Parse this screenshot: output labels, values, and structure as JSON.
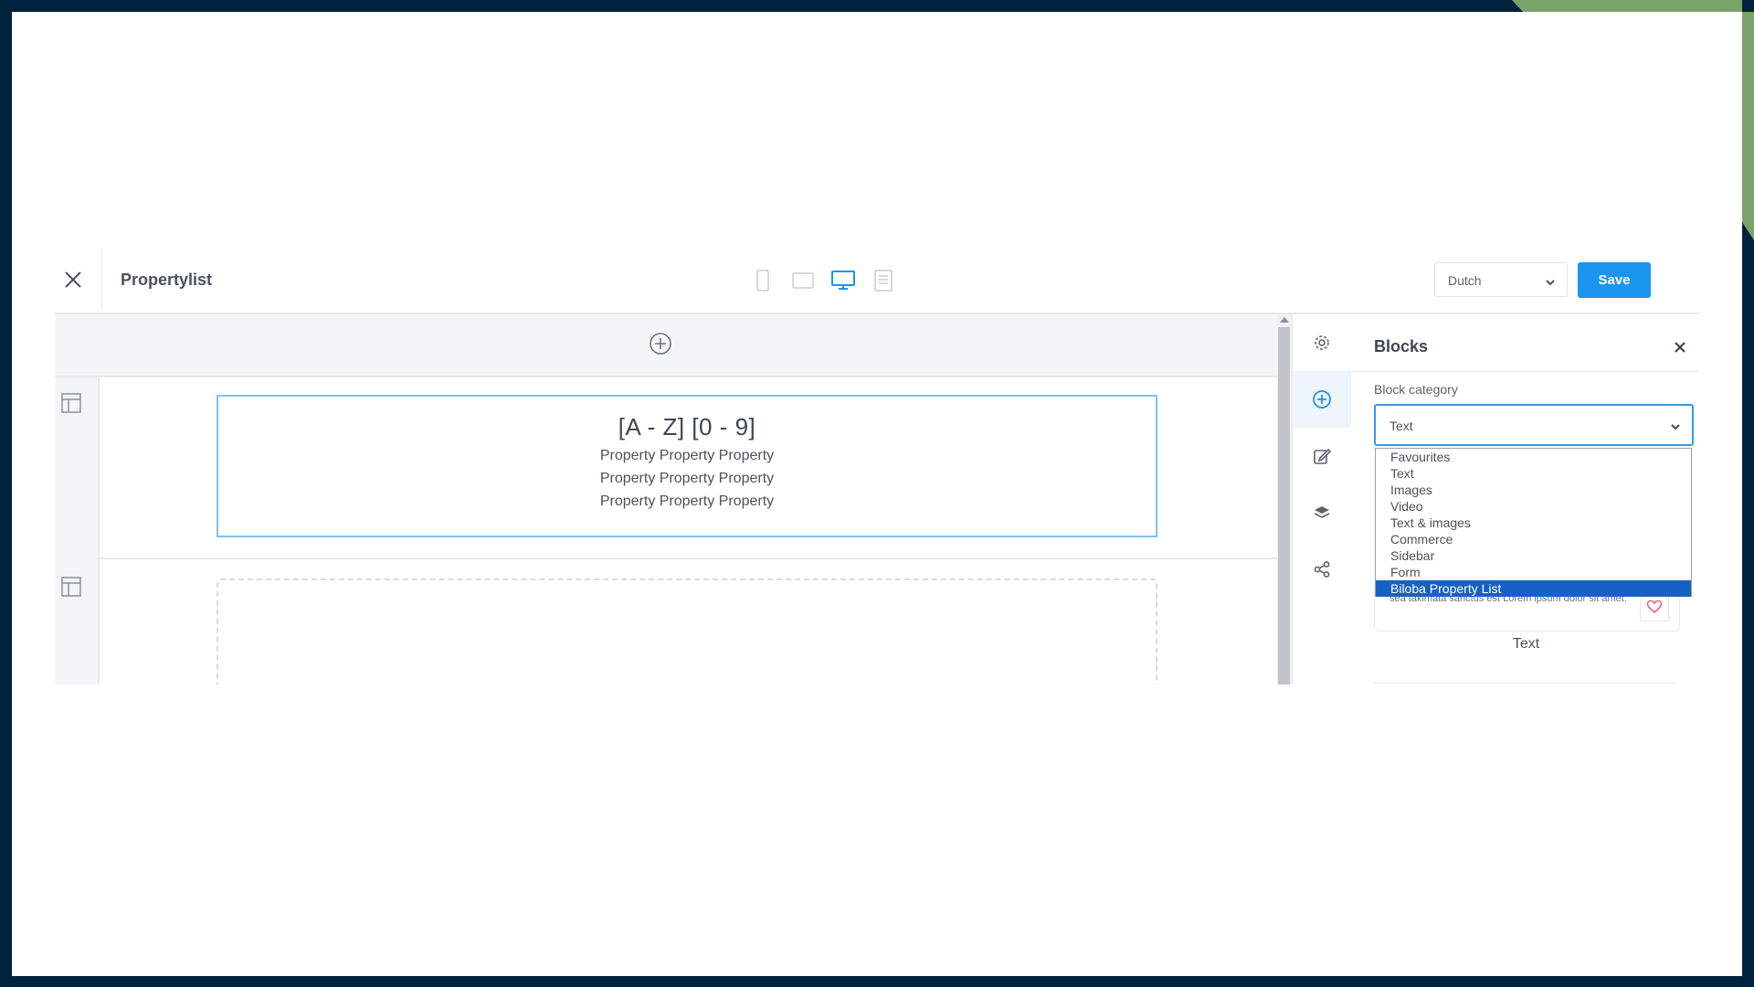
{
  "toolbar": {
    "title": "Propertylist",
    "language": "Dutch",
    "save_label": "Save",
    "devices": [
      "mobile",
      "tablet",
      "desktop",
      "document"
    ],
    "active_device": "desktop"
  },
  "canvas": {
    "heading": "[A - Z] [0 - 9]",
    "property_lines": [
      "Property Property Property",
      "Property Property Property",
      "Property Property Property"
    ]
  },
  "rail": {
    "items": [
      "settings-icon",
      "add-block-icon",
      "edit-icon",
      "layers-icon",
      "share-icon"
    ],
    "active": "add-block-icon"
  },
  "panel": {
    "title": "Blocks",
    "category_label": "Block category",
    "category_value": "Text",
    "category_options": [
      "Favourites",
      "Text",
      "Images",
      "Video",
      "Text & images",
      "Commerce",
      "Sidebar",
      "Form",
      "Biloba Property List"
    ],
    "highlighted_option": "Biloba Property List",
    "card_text": "sea takimata sanctus est Lorem ipsum dolor sit amet.",
    "card_caption": "Text"
  },
  "colors": {
    "frame": "#00223d",
    "frame_accent": "#7aa36a",
    "primary": "#1a95f0",
    "selected_option": "#1463c2"
  }
}
